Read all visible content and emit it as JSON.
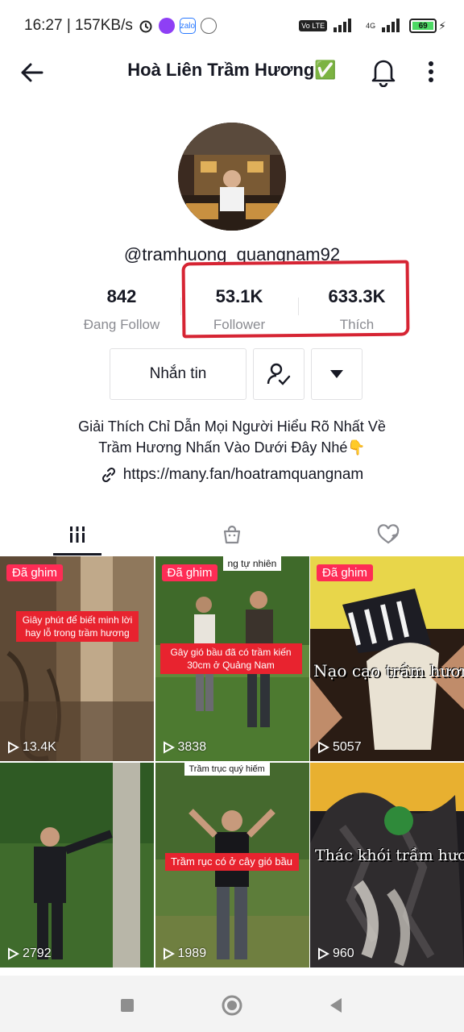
{
  "status_bar": {
    "time_speed": "16:27 | 157KB/s",
    "network_tag": "4G",
    "battery": "69"
  },
  "header": {
    "title": "Hoà Liên Trầm Hương",
    "verified_mark": "✅"
  },
  "profile": {
    "username": "@tramhuong_quangnam92",
    "stats": [
      {
        "value": "842",
        "label": "Đang Follow"
      },
      {
        "value": "53.1K",
        "label": "Follower"
      },
      {
        "value": "633.3K",
        "label": "Thích"
      }
    ],
    "message_button": "Nhắn tin",
    "bio_line1": "Giải Thích Chỉ Dẫn Mọi Người Hiểu Rõ Nhất Về",
    "bio_line2": "Trầm Hương Nhấn Vào Dưới Đây Nhé👇",
    "link": "https://many.fan/hoatramquangnam",
    "highlight_color": "#d62433"
  },
  "tabs": [
    {
      "icon": "grid-icon",
      "active": true
    },
    {
      "icon": "shopping-bag-icon",
      "active": false
    },
    {
      "icon": "liked-hidden-icon",
      "active": false
    }
  ],
  "videos": [
    {
      "pinned": "Đã ghim",
      "views": "13.4K",
      "caption": "Giây phút để biết minh lời hay lỗ trong trầm hương"
    },
    {
      "pinned": "Đã ghim",
      "views": "3838",
      "top_text": "ng tự nhiên",
      "caption": "Gây gió bầu đã có trầm kiến 30cm ở Quảng Nam"
    },
    {
      "pinned": "Đã ghim",
      "views": "5057",
      "caption": "Nạo cạo trầm hương"
    },
    {
      "views": "2792"
    },
    {
      "views": "1989",
      "top_text": "Trầm trục quý hiếm",
      "caption": "Trầm rục có ở cây gió bầu"
    },
    {
      "views": "960",
      "caption": "Thác khói trầm hương"
    }
  ],
  "colors": {
    "pin": "#fe2c55",
    "text": "#161823",
    "muted": "#8a8b91"
  }
}
